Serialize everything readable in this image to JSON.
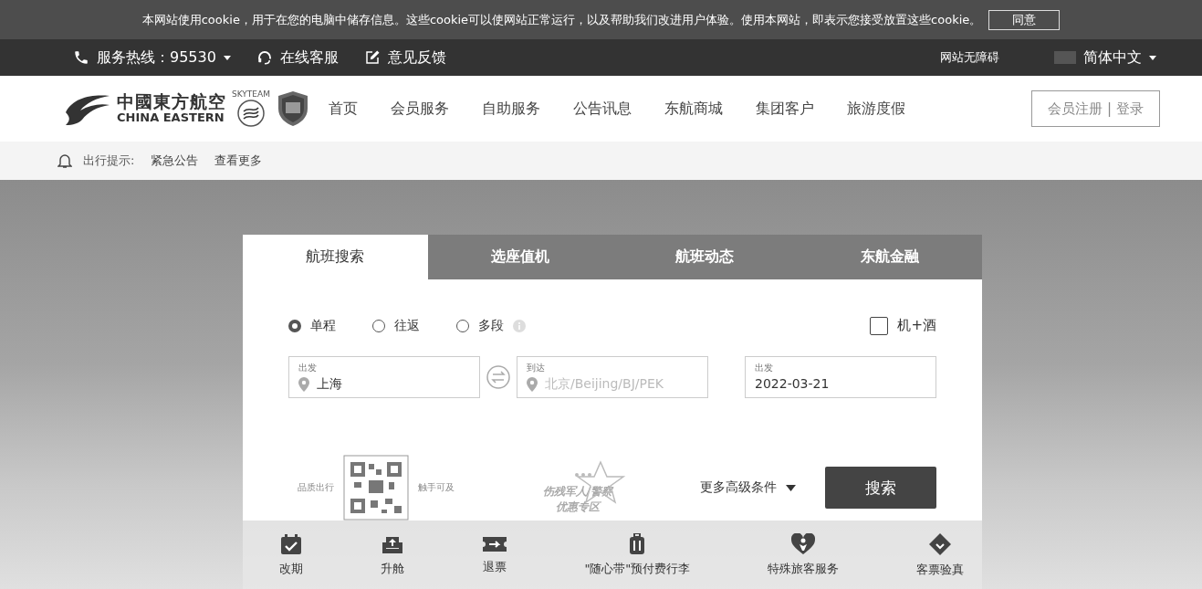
{
  "cookie_banner": {
    "text": "本网站使用cookie，用于在您的电脑中储存信息。这些cookie可以使网站正常运行，以及帮助我们改进用户体验。使用本网站，即表示您接受放置这些cookie。",
    "button": "同意"
  },
  "top_bar": {
    "hotline": "服务热线：95530",
    "links": [
      {
        "label": "在线客服",
        "kind": "headset"
      },
      {
        "label": "意见反馈",
        "kind": "edit"
      }
    ],
    "accessibility": "网站无障碍",
    "language": "简体中文"
  },
  "header": {
    "logo": {
      "name_cn": "中國東方航空",
      "name_en": "CHINA EASTERN",
      "alliance": "SKYTEAM"
    },
    "nav": [
      "首页",
      "会员服务",
      "自助服务",
      "公告讯息",
      "东航商城",
      "集团客户",
      "旅游度假"
    ],
    "login": "会员注册 | 登录"
  },
  "notice": {
    "label": "出行提示:",
    "items": [
      "紧急公告",
      "查看更多"
    ]
  },
  "search": {
    "tabs": [
      {
        "label": "航班搜索",
        "selected": true
      },
      {
        "label": "选座值机",
        "selected": false
      },
      {
        "label": "航班动态",
        "selected": false
      },
      {
        "label": "东航金融",
        "selected": false
      }
    ],
    "trip_types": [
      {
        "label": "单程",
        "selected": true,
        "info": false
      },
      {
        "label": "往返",
        "selected": false,
        "info": false
      },
      {
        "label": "多段",
        "selected": false,
        "info": true
      }
    ],
    "package": {
      "label": "机+酒",
      "checked": false
    },
    "fields": [
      {
        "label": "出发",
        "value": "上海",
        "kind": "city"
      },
      {
        "label": "到达",
        "placeholder": "北京/Beijing/BJ/PEK",
        "kind": "city"
      },
      {
        "label": "出发",
        "value": "2022-03-21",
        "kind": "date"
      }
    ],
    "qr": {
      "left": "品质出行",
      "right": "触手可及"
    },
    "promo": {
      "line1": "伤残军人/警察",
      "line2": "优惠专区"
    },
    "more": "更多高级条件",
    "button": "搜索"
  },
  "services": [
    {
      "label": "改期",
      "kind": "calendar"
    },
    {
      "label": "升舱",
      "kind": "seat"
    },
    {
      "label": "退票",
      "kind": "ticket"
    },
    {
      "label": "\"随心带\"预付费行李",
      "kind": "luggage"
    },
    {
      "label": "特殊旅客服务",
      "kind": "heart"
    },
    {
      "label": "客票验真",
      "kind": "tag"
    }
  ]
}
